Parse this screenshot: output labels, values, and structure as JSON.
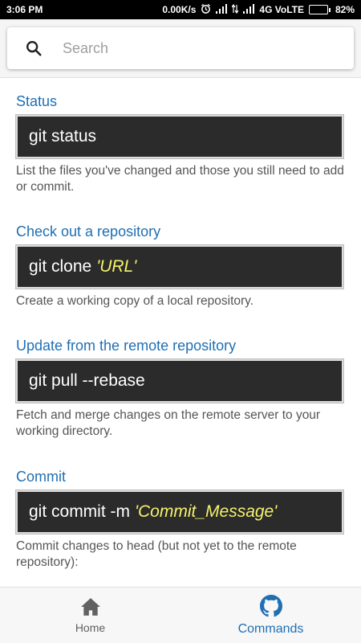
{
  "status_bar": {
    "time": "3:06 PM",
    "network_speed": "0.00K/s",
    "network_type": "4G VoLTE",
    "battery": "82%",
    "battery_level": 0.82,
    "icons": [
      "alarm-icon",
      "signal-icon",
      "signal-icon",
      "battery-icon"
    ]
  },
  "search": {
    "placeholder": "Search",
    "value": "",
    "icon": "search-icon"
  },
  "sections": [
    {
      "title": "Status",
      "command": "git status",
      "argument": "",
      "description": "List the files you've changed and those you still need to add or commit."
    },
    {
      "title": "Check out a repository",
      "command": "git clone",
      "argument": "'URL'",
      "description": "Create a working copy of a local repository."
    },
    {
      "title": "Update from the remote repository",
      "command": "git pull --rebase",
      "argument": "",
      "description": "Fetch and merge changes on the remote server to your working directory."
    },
    {
      "title": "Commit",
      "command": "git commit -m",
      "argument": "'Commit_Message'",
      "description": "Commit changes to head (but not yet to the remote repository):"
    }
  ],
  "bottom_nav": {
    "items": [
      {
        "label": "Home",
        "icon": "home-icon",
        "active": false
      },
      {
        "label": "Commands",
        "icon": "github-icon",
        "active": true
      }
    ]
  },
  "colors": {
    "accent": "#1f6fb2",
    "code_background": "#2b2b2b",
    "code_argument": "#f4f36a",
    "battery": "#4cd964"
  }
}
